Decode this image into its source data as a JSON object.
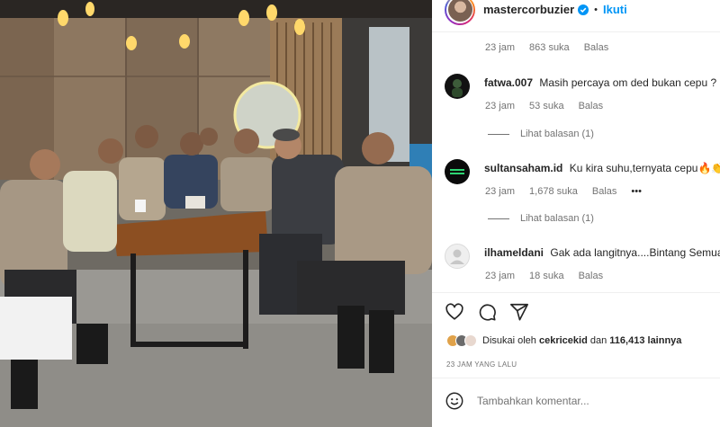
{
  "post": {
    "username": "mastercorbuzier",
    "follow_label": "Ikuti",
    "separator": "•",
    "photo_alt": "Group photo in a cafe"
  },
  "first_comment_meta": {
    "time": "23 jam",
    "likes": "863 suka",
    "reply": "Balas"
  },
  "comments": [
    {
      "username": "fatwa.007",
      "text": "Masih percaya om ded bukan cepu ? 😂",
      "time": "23 jam",
      "likes": "53 suka",
      "reply": "Balas",
      "view_replies": "Lihat balasan (1)",
      "avatar_color": "#0f0f0f"
    },
    {
      "username": "sultansaham.id",
      "text": "Ku kira suhu,ternyata cepu🔥👏",
      "time": "23 jam",
      "likes": "1,678 suka",
      "reply": "Balas",
      "more": "•••",
      "view_replies": "Lihat balasan (1)",
      "avatar_color": "#0b0b0b",
      "avatar_accent": "#2ed573"
    },
    {
      "username": "ilhameldani",
      "text": "Gak ada langitnya....Bintang Semuaaa",
      "time": "23 jam",
      "likes": "18 suka",
      "reply": "Balas",
      "avatar_color": "#dbdbdb"
    }
  ],
  "actions": {
    "like_icon": "heart-icon",
    "comment_icon": "comment-icon",
    "share_icon": "share-icon"
  },
  "likes_summary": {
    "prefix": "Disukai oleh",
    "user": "cekricekid",
    "middle": "dan",
    "count": "116,413 lainnya"
  },
  "post_time": "23 JAM YANG LALU",
  "add_comment": {
    "placeholder": "Tambahkan komentar..."
  },
  "colors": {
    "accent": "#0095f6",
    "secondary_text": "#737373",
    "primary_text": "#262626"
  }
}
